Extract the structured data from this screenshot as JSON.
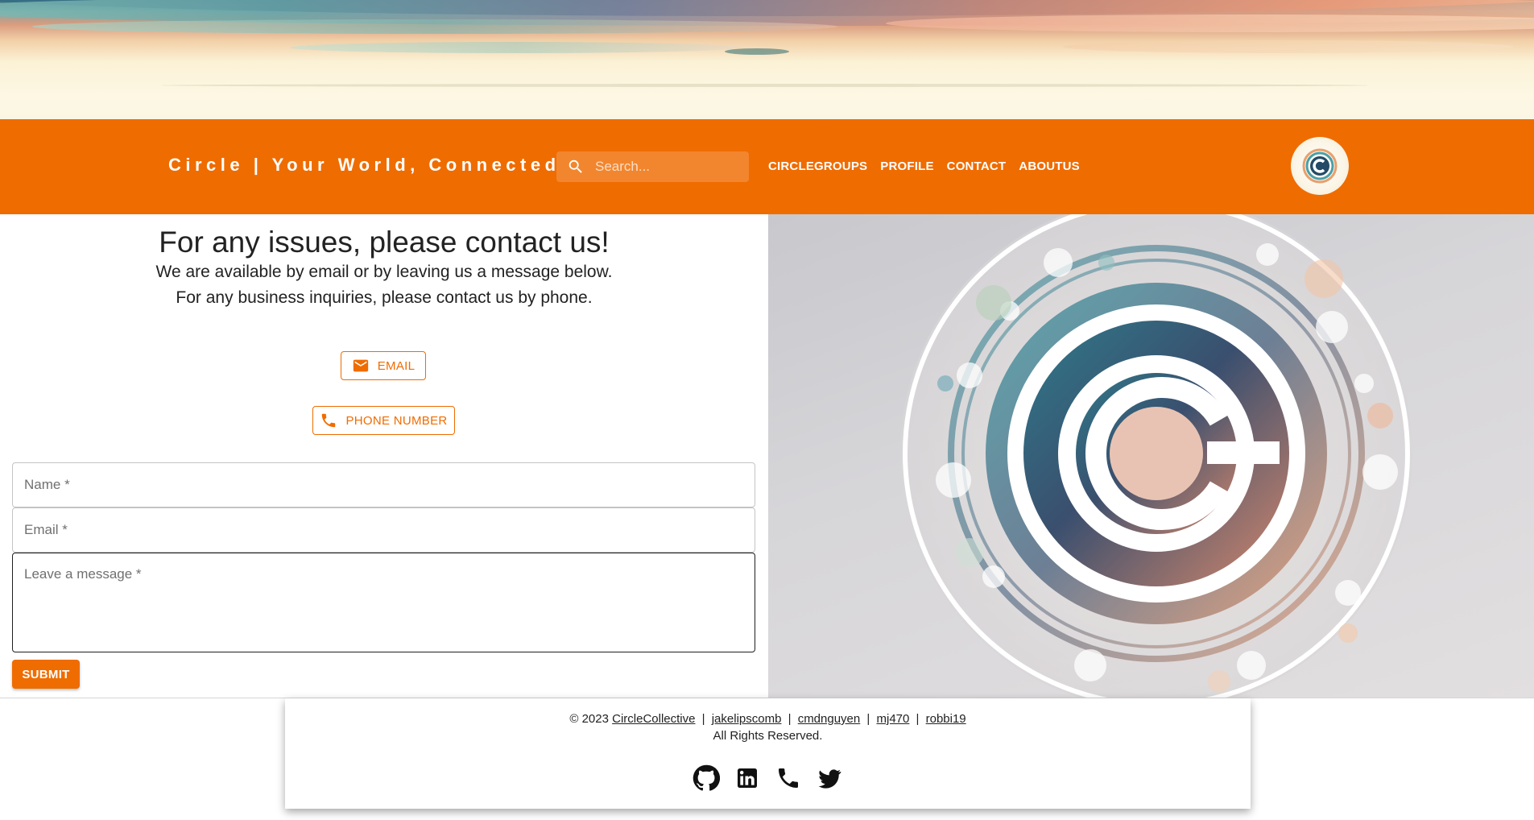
{
  "header": {
    "brand": "Circle | Your World, Connected",
    "search_placeholder": "Search...",
    "nav": [
      {
        "label": "CIRCLEGROUPS"
      },
      {
        "label": "PROFILE"
      },
      {
        "label": "CONTACT"
      },
      {
        "label": "ABOUTUS"
      }
    ],
    "accent_color": "#ef6c00"
  },
  "contact": {
    "title": "For any issues, please contact us!",
    "subtitle_1": "We are available by email or by leaving us a message below.",
    "subtitle_2": "For any business inquiries, please contact us by phone.",
    "email_button": "EMAIL",
    "phone_button": "PHONE NUMBER",
    "form": {
      "name_placeholder": "Name *",
      "email_placeholder": "Email *",
      "message_placeholder": "Leave a message *",
      "submit_label": "SUBMIT"
    }
  },
  "footer": {
    "copyright": "© 2023",
    "links": [
      "CircleCollective",
      "jakelipscomb",
      "cmdnguyen",
      "mj470",
      "robbi19"
    ],
    "separator": "|",
    "rights": "All Rights Reserved.",
    "socials": [
      "github-icon",
      "linkedin-icon",
      "phone-icon",
      "twitter-icon"
    ]
  }
}
